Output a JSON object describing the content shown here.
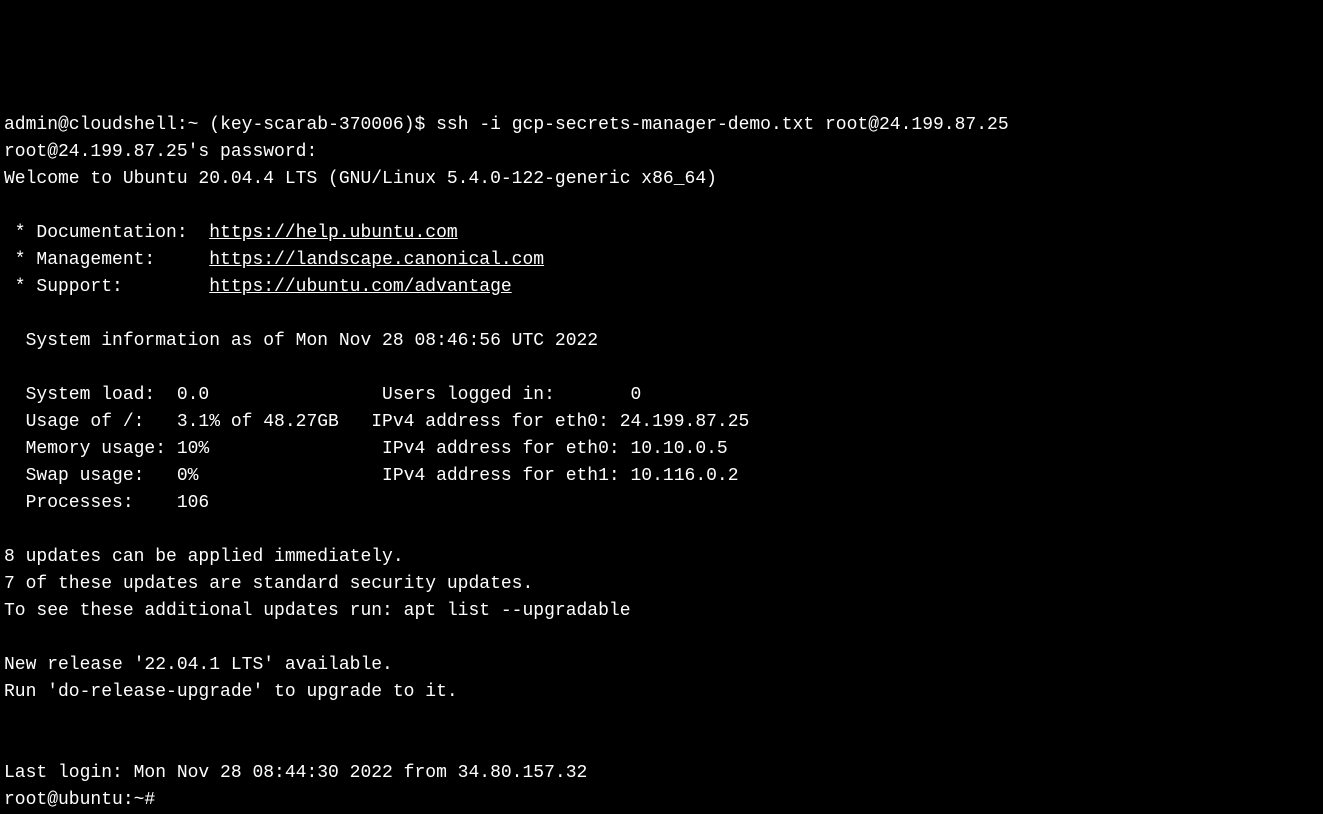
{
  "terminal": {
    "prompt1_user": "admin@cloudshell",
    "prompt1_path": "~",
    "prompt1_project": "(key-scarab-370006)",
    "prompt1_symbol": "$",
    "command": "ssh -i gcp-secrets-manager-demo.txt root@24.199.87.25",
    "password_line": "root@24.199.87.25's password:",
    "welcome": "Welcome to Ubuntu 20.04.4 LTS (GNU/Linux 5.4.0-122-generic x86_64)",
    "links": {
      "doc_label": " * Documentation:  ",
      "doc_url": "https://help.ubuntu.com",
      "mgmt_label": " * Management:     ",
      "mgmt_url": "https://landscape.canonical.com",
      "support_label": " * Support:        ",
      "support_url": "https://ubuntu.com/advantage"
    },
    "sysinfo_header": "  System information as of Mon Nov 28 08:46:56 UTC 2022",
    "stats": {
      "line1": "  System load:  0.0                Users logged in:       0",
      "line2": "  Usage of /:   3.1% of 48.27GB   IPv4 address for eth0: 24.199.87.25",
      "line3": "  Memory usage: 10%                IPv4 address for eth0: 10.10.0.5",
      "line4": "  Swap usage:   0%                 IPv4 address for eth1: 10.116.0.2",
      "line5": "  Processes:    106"
    },
    "updates": {
      "line1": "8 updates can be applied immediately.",
      "line2": "7 of these updates are standard security updates.",
      "line3": "To see these additional updates run: apt list --upgradable"
    },
    "release": {
      "line1": "New release '22.04.1 LTS' available.",
      "line2": "Run 'do-release-upgrade' to upgrade to it."
    },
    "last_login": "Last login: Mon Nov 28 08:44:30 2022 from 34.80.157.32",
    "prompt2": "root@ubuntu:~#"
  }
}
